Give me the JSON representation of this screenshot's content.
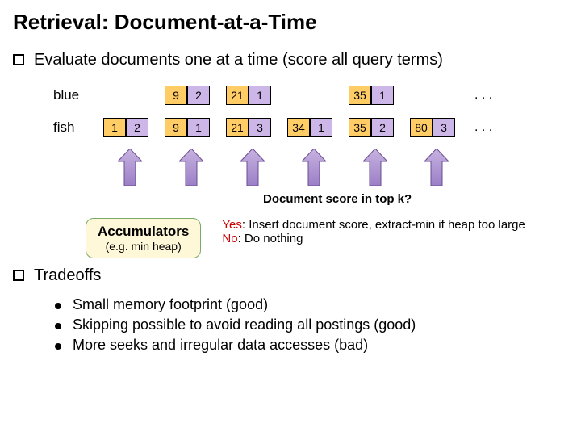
{
  "title": "Retrieval: Document-at-a-Time",
  "bullets": {
    "evaluate": "Evaluate documents one at a time (score all query terms)",
    "tradeoffs": "Tradeoffs"
  },
  "terms": {
    "blue": "blue",
    "fish": "fish"
  },
  "ellipsis": ". . .",
  "blue_list": [
    {
      "doc": "9",
      "tf": "2"
    },
    {
      "doc": "21",
      "tf": "1"
    },
    {
      "doc": "35",
      "tf": "1"
    }
  ],
  "fish_list": [
    {
      "doc": "1",
      "tf": "2"
    },
    {
      "doc": "9",
      "tf": "1"
    },
    {
      "doc": "21",
      "tf": "3"
    },
    {
      "doc": "34",
      "tf": "1"
    },
    {
      "doc": "35",
      "tf": "2"
    },
    {
      "doc": "80",
      "tf": "3"
    }
  ],
  "accumulators": {
    "label": "Accumulators",
    "sub": "(e.g. min heap)"
  },
  "score_q": "Document score in top k?",
  "score_yes_label": "Yes",
  "score_yes_text": ": Insert document score, extract-min if heap too large",
  "score_no_label": "No",
  "score_no_text": ": Do nothing",
  "tradeoffs_list": [
    "Small memory footprint (good)",
    "Skipping possible to avoid reading all postings (good)",
    "More seeks and irregular data accesses (bad)"
  ]
}
